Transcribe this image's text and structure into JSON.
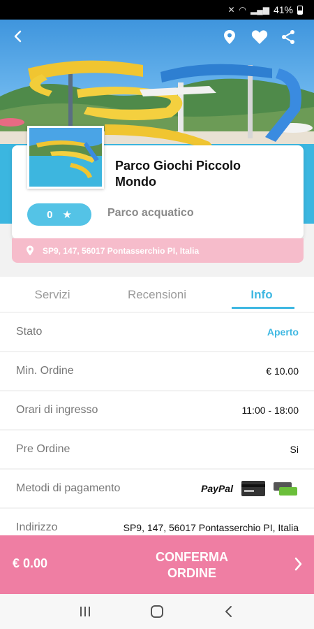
{
  "status_bar": {
    "battery": "41%"
  },
  "place": {
    "name": "Parco Giochi Piccolo Mondo",
    "rating": "0",
    "rating_icon": "star-icon",
    "category": "Parco acquatico",
    "address": "SP9, 147, 56017 Pontasserchio PI, Italia"
  },
  "tabs": [
    {
      "label": "Servizi",
      "active": false
    },
    {
      "label": "Recensioni",
      "active": false
    },
    {
      "label": "Info",
      "active": true
    }
  ],
  "info": {
    "stato": {
      "label": "Stato",
      "value": "Aperto"
    },
    "min_order": {
      "label": "Min. Ordine",
      "value": "€ 10.00"
    },
    "hours": {
      "label": "Orari di ingresso",
      "value": "11:00 - 18:00"
    },
    "preorder": {
      "label": "Pre Ordine",
      "value": "Si"
    },
    "payment": {
      "label": "Metodi di pagamento",
      "paypal": "PayPal"
    },
    "address": {
      "label": "Indirizzo",
      "value": "SP9, 147, 56017 Pontasserchio PI, Italia"
    }
  },
  "bottom_bar": {
    "total": "€ 0.00",
    "confirm_label": "CONFERMA ORDINE"
  },
  "colors": {
    "accent": "#3fb8e2",
    "pink": "#ef7ea3",
    "address_bg": "#f6bccb"
  }
}
